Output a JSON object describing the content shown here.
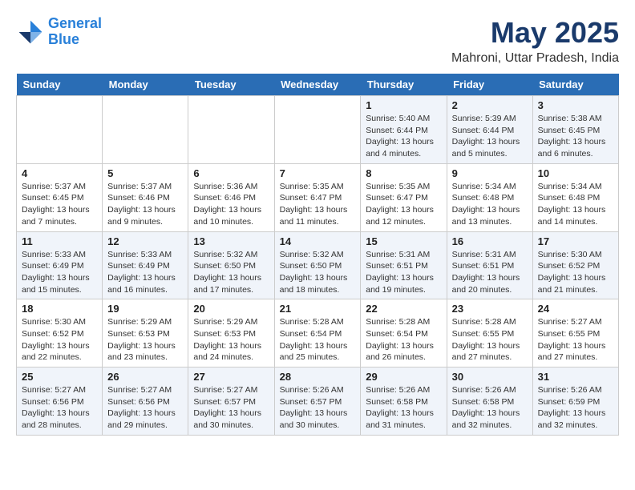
{
  "logo": {
    "line1": "General",
    "line2": "Blue"
  },
  "title": "May 2025",
  "subtitle": "Mahroni, Uttar Pradesh, India",
  "days_of_week": [
    "Sunday",
    "Monday",
    "Tuesday",
    "Wednesday",
    "Thursday",
    "Friday",
    "Saturday"
  ],
  "weeks": [
    [
      {
        "day": "",
        "info": ""
      },
      {
        "day": "",
        "info": ""
      },
      {
        "day": "",
        "info": ""
      },
      {
        "day": "",
        "info": ""
      },
      {
        "day": "1",
        "info": "Sunrise: 5:40 AM\nSunset: 6:44 PM\nDaylight: 13 hours\nand 4 minutes."
      },
      {
        "day": "2",
        "info": "Sunrise: 5:39 AM\nSunset: 6:44 PM\nDaylight: 13 hours\nand 5 minutes."
      },
      {
        "day": "3",
        "info": "Sunrise: 5:38 AM\nSunset: 6:45 PM\nDaylight: 13 hours\nand 6 minutes."
      }
    ],
    [
      {
        "day": "4",
        "info": "Sunrise: 5:37 AM\nSunset: 6:45 PM\nDaylight: 13 hours\nand 7 minutes."
      },
      {
        "day": "5",
        "info": "Sunrise: 5:37 AM\nSunset: 6:46 PM\nDaylight: 13 hours\nand 9 minutes."
      },
      {
        "day": "6",
        "info": "Sunrise: 5:36 AM\nSunset: 6:46 PM\nDaylight: 13 hours\nand 10 minutes."
      },
      {
        "day": "7",
        "info": "Sunrise: 5:35 AM\nSunset: 6:47 PM\nDaylight: 13 hours\nand 11 minutes."
      },
      {
        "day": "8",
        "info": "Sunrise: 5:35 AM\nSunset: 6:47 PM\nDaylight: 13 hours\nand 12 minutes."
      },
      {
        "day": "9",
        "info": "Sunrise: 5:34 AM\nSunset: 6:48 PM\nDaylight: 13 hours\nand 13 minutes."
      },
      {
        "day": "10",
        "info": "Sunrise: 5:34 AM\nSunset: 6:48 PM\nDaylight: 13 hours\nand 14 minutes."
      }
    ],
    [
      {
        "day": "11",
        "info": "Sunrise: 5:33 AM\nSunset: 6:49 PM\nDaylight: 13 hours\nand 15 minutes."
      },
      {
        "day": "12",
        "info": "Sunrise: 5:33 AM\nSunset: 6:49 PM\nDaylight: 13 hours\nand 16 minutes."
      },
      {
        "day": "13",
        "info": "Sunrise: 5:32 AM\nSunset: 6:50 PM\nDaylight: 13 hours\nand 17 minutes."
      },
      {
        "day": "14",
        "info": "Sunrise: 5:32 AM\nSunset: 6:50 PM\nDaylight: 13 hours\nand 18 minutes."
      },
      {
        "day": "15",
        "info": "Sunrise: 5:31 AM\nSunset: 6:51 PM\nDaylight: 13 hours\nand 19 minutes."
      },
      {
        "day": "16",
        "info": "Sunrise: 5:31 AM\nSunset: 6:51 PM\nDaylight: 13 hours\nand 20 minutes."
      },
      {
        "day": "17",
        "info": "Sunrise: 5:30 AM\nSunset: 6:52 PM\nDaylight: 13 hours\nand 21 minutes."
      }
    ],
    [
      {
        "day": "18",
        "info": "Sunrise: 5:30 AM\nSunset: 6:52 PM\nDaylight: 13 hours\nand 22 minutes."
      },
      {
        "day": "19",
        "info": "Sunrise: 5:29 AM\nSunset: 6:53 PM\nDaylight: 13 hours\nand 23 minutes."
      },
      {
        "day": "20",
        "info": "Sunrise: 5:29 AM\nSunset: 6:53 PM\nDaylight: 13 hours\nand 24 minutes."
      },
      {
        "day": "21",
        "info": "Sunrise: 5:28 AM\nSunset: 6:54 PM\nDaylight: 13 hours\nand 25 minutes."
      },
      {
        "day": "22",
        "info": "Sunrise: 5:28 AM\nSunset: 6:54 PM\nDaylight: 13 hours\nand 26 minutes."
      },
      {
        "day": "23",
        "info": "Sunrise: 5:28 AM\nSunset: 6:55 PM\nDaylight: 13 hours\nand 27 minutes."
      },
      {
        "day": "24",
        "info": "Sunrise: 5:27 AM\nSunset: 6:55 PM\nDaylight: 13 hours\nand 27 minutes."
      }
    ],
    [
      {
        "day": "25",
        "info": "Sunrise: 5:27 AM\nSunset: 6:56 PM\nDaylight: 13 hours\nand 28 minutes."
      },
      {
        "day": "26",
        "info": "Sunrise: 5:27 AM\nSunset: 6:56 PM\nDaylight: 13 hours\nand 29 minutes."
      },
      {
        "day": "27",
        "info": "Sunrise: 5:27 AM\nSunset: 6:57 PM\nDaylight: 13 hours\nand 30 minutes."
      },
      {
        "day": "28",
        "info": "Sunrise: 5:26 AM\nSunset: 6:57 PM\nDaylight: 13 hours\nand 30 minutes."
      },
      {
        "day": "29",
        "info": "Sunrise: 5:26 AM\nSunset: 6:58 PM\nDaylight: 13 hours\nand 31 minutes."
      },
      {
        "day": "30",
        "info": "Sunrise: 5:26 AM\nSunset: 6:58 PM\nDaylight: 13 hours\nand 32 minutes."
      },
      {
        "day": "31",
        "info": "Sunrise: 5:26 AM\nSunset: 6:59 PM\nDaylight: 13 hours\nand 32 minutes."
      }
    ]
  ]
}
